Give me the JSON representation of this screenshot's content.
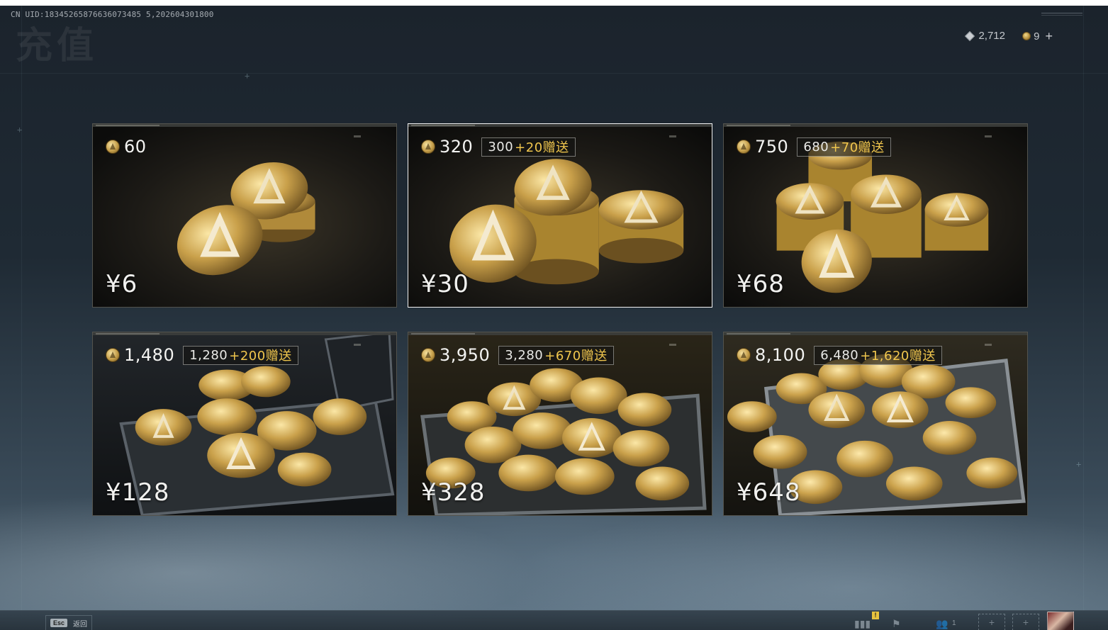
{
  "header": {
    "uid_text": "CN UID:18345265876636073485 5,202604301800",
    "page_title": "充值",
    "diamond_balance": "2,712",
    "coin_balance": "9",
    "diamond_icon": "diamond-icon",
    "coin_icon": "coin-icon",
    "add_icon": "plus-icon"
  },
  "packages": [
    {
      "amount": "60",
      "base": "",
      "extra": "",
      "price": "¥6"
    },
    {
      "amount": "320",
      "base": "300",
      "extra": "+20赠送",
      "price": "¥30"
    },
    {
      "amount": "750",
      "base": "680",
      "extra": "+70赠送",
      "price": "¥68"
    },
    {
      "amount": "1,480",
      "base": "1,280",
      "extra": "+200赠送",
      "price": "¥128"
    },
    {
      "amount": "3,950",
      "base": "3,280",
      "extra": "+670赠送",
      "price": "¥328"
    },
    {
      "amount": "8,100",
      "base": "6,480",
      "extra": "+1,620赠送",
      "price": "¥648"
    }
  ],
  "selected_package_index": 1,
  "footer": {
    "esc_key": "Esc",
    "back_label": "返回",
    "alert_badge": "!",
    "friend_count": "1"
  },
  "colors": {
    "bonus_accent": "#f0c64d",
    "selected_border": "#f2f2f2",
    "background": "#1f2a34"
  }
}
